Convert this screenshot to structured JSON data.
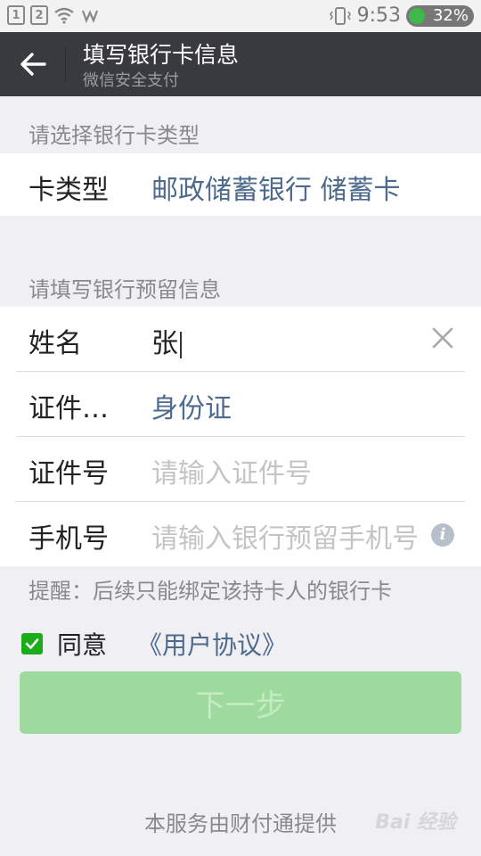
{
  "status_bar": {
    "sim1": "1",
    "sim2": "2",
    "time": "9:53",
    "battery": "32%",
    "battery_color": "#3fb84a"
  },
  "header": {
    "title": "填写银行卡信息",
    "subtitle": "微信安全支付",
    "background": "#393a3f"
  },
  "card_type_section": {
    "title": "请选择银行卡类型",
    "label": "卡类型",
    "value": "邮政储蓄银行 储蓄卡"
  },
  "info_section": {
    "title": "请填写银行预留信息",
    "fields": [
      {
        "label": "姓名",
        "value": "张"
      },
      {
        "label": "证件…",
        "value": "身份证"
      },
      {
        "label": "证件号",
        "placeholder": "请输入证件号"
      },
      {
        "label": "手机号",
        "placeholder": "请输入银行预留手机号"
      }
    ]
  },
  "tip": "提醒：后续只能绑定该持卡人的银行卡",
  "agreement": {
    "checked": true,
    "label": "同意",
    "link": "《用户协议》"
  },
  "next_button": {
    "label": "下一步",
    "color": "#9ed99d"
  },
  "footer": "本服务由财付通提供",
  "watermark": "Bai 经验"
}
